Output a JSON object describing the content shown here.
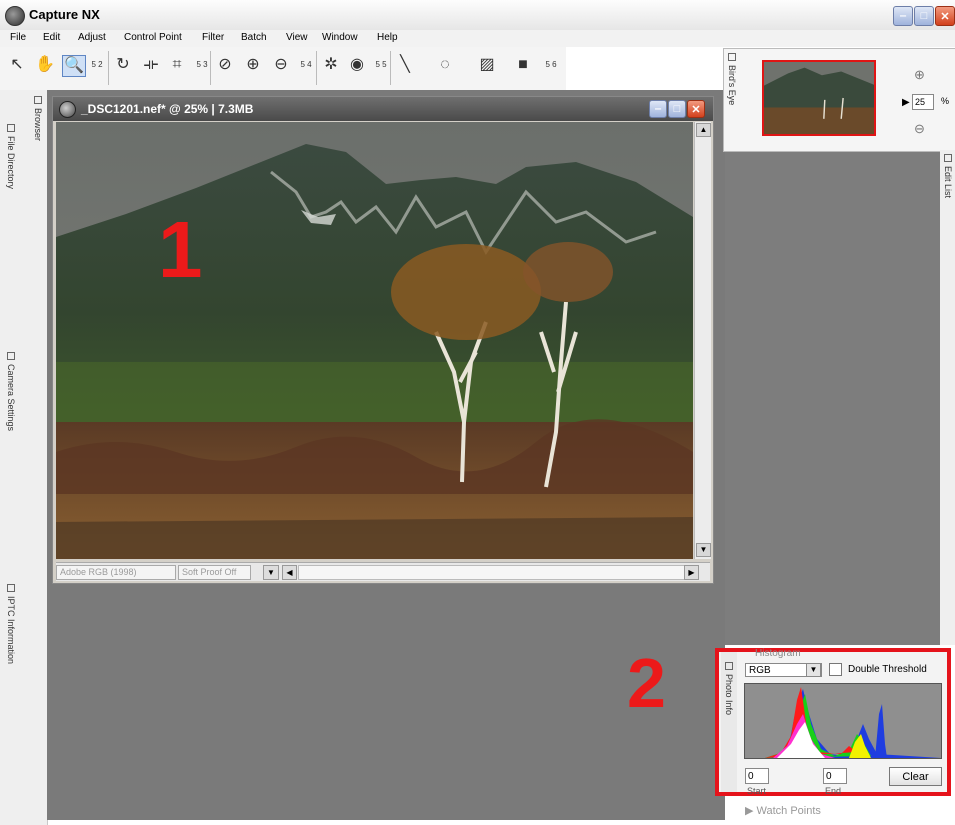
{
  "app": {
    "title": "Capture NX"
  },
  "menu": [
    "File",
    "Edit",
    "Adjust",
    "Control Point",
    "Filter",
    "Batch",
    "View",
    "Window",
    "Help"
  ],
  "toolbar": {
    "tools": [
      "select-arrow",
      "hand",
      "zoom",
      "rotate",
      "straighten",
      "crop",
      "red-eye",
      "brush-plus",
      "brush-minus",
      "color-control-point",
      "eye",
      "line",
      "lasso",
      "gradient",
      "fill"
    ],
    "group_labels": [
      "5 2",
      "5 3",
      "5 4",
      "5 5",
      "5 6"
    ]
  },
  "left_sidebar": {
    "tabs": [
      "Browser",
      "File Directory",
      "Camera Settings",
      "IPTC Information"
    ]
  },
  "image_window": {
    "title": "_DSC1201.nef* @ 25% | 7.3MB",
    "color_space": "Adobe RGB (1998)",
    "soft_proof": "Soft Proof Off"
  },
  "birds_eye": {
    "tab_label": "Bird's Eye",
    "zoom_value": "25",
    "zoom_unit": "%"
  },
  "edit_list": {
    "tab_label": "Edit List"
  },
  "histogram": {
    "title": "Histogram",
    "photo_info_label": "Photo Info",
    "channel": "RGB",
    "double_threshold_label": "Double Threshold",
    "start_value": "0",
    "end_value": "0",
    "clear_label": "Clear",
    "start_label": "Start",
    "end_label": "End"
  },
  "watch_points": {
    "label": "Watch Points"
  },
  "annotations": {
    "one": "1",
    "two": "2"
  },
  "colors": {
    "annotation_red": "#ec1a1a",
    "workspace_gray": "#7a7a7a",
    "highlight_box": "#e5131b"
  }
}
